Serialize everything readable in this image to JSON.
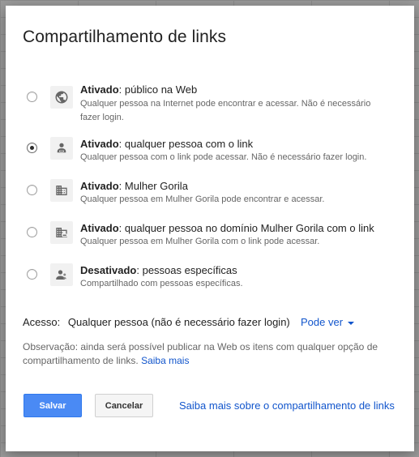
{
  "dialog": {
    "title": "Compartilhamento de links"
  },
  "options": [
    {
      "state": "Ativado",
      "suffix": ": público na Web",
      "description": "Qualquer pessoa na Internet pode encontrar e acessar. Não é necessário fazer login.",
      "icon": "globe-icon",
      "selected": false
    },
    {
      "state": "Ativado",
      "suffix": ": qualquer pessoa com o link",
      "description": "Qualquer pessoa com o link pode acessar. Não é necessário fazer login.",
      "icon": "person-link-icon",
      "selected": true
    },
    {
      "state": "Ativado",
      "suffix": ": Mulher Gorila",
      "description": "Qualquer pessoa em Mulher Gorila pode encontrar e acessar.",
      "icon": "building-icon",
      "selected": false
    },
    {
      "state": "Ativado",
      "suffix": ": qualquer pessoa no domínio Mulher Gorila com o link",
      "description": "Qualquer pessoa em Mulher Gorila com o link pode acessar.",
      "icon": "building-link-icon",
      "selected": false
    },
    {
      "state": "Desativado",
      "suffix": ": pessoas específicas",
      "description": "Compartilhado com pessoas específicas.",
      "icon": "people-icon",
      "selected": false
    }
  ],
  "access": {
    "label": "Acesso:",
    "value": "Qualquer pessoa (não é necessário fazer login)",
    "permission": "Pode ver"
  },
  "note": {
    "text": "Observação: ainda será possível publicar na Web os itens com qualquer opção de compartilhamento de links.",
    "link": "Saiba mais"
  },
  "buttons": {
    "save": "Salvar",
    "cancel": "Cancelar"
  },
  "footer": {
    "link": "Saiba mais sobre o compartilhamento de links"
  },
  "colors": {
    "primary_button": "#4a8af4",
    "link": "#1155cc"
  }
}
